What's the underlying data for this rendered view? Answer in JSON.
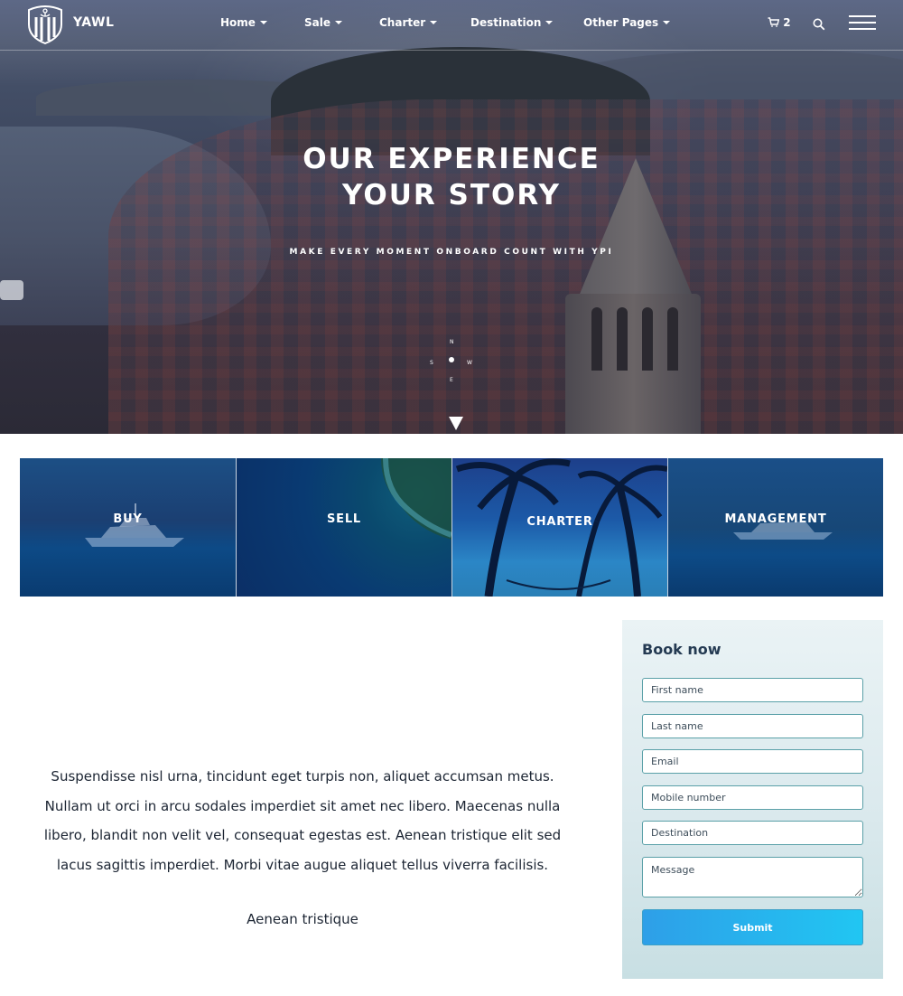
{
  "header": {
    "brand": "YAWL",
    "nav": [
      {
        "label": "Home"
      },
      {
        "label": "Sale"
      },
      {
        "label": "Charter"
      },
      {
        "label": "Destination"
      },
      {
        "label": "Other Pages"
      }
    ],
    "cart_count": "2"
  },
  "hero": {
    "title_line1": "OUR EXPERIENCE",
    "title_line2": "YOUR STORY",
    "subtitle": "MAKE EVERY MOMENT ONBOARD COUNT WITH YPI",
    "compass_letters": [
      "N",
      "W",
      "E",
      "S"
    ]
  },
  "tiles": [
    {
      "label": "BUY"
    },
    {
      "label": "SELL"
    },
    {
      "label": "CHARTER"
    },
    {
      "label": "MANAGEMENT"
    }
  ],
  "content": {
    "paragraph": "Suspendisse nisl urna, tincidunt eget turpis non, aliquet accumsan metus. Nullam ut orci in arcu sodales imperdiet sit amet nec libero. Maecenas nulla libero, blandit non velit vel, consequat egestas est. Aenean tristique elit sed lacus sagittis imperdiet. Morbi vitae augue aliquet tellus viverra facilisis.",
    "paragraph_tail": "Aenean tristique"
  },
  "booking": {
    "title": "Book now",
    "first_name_placeholder": "First name",
    "last_name_placeholder": "Last name",
    "email_placeholder": "Email",
    "mobile_placeholder": "Mobile number",
    "destination_placeholder": "Destination",
    "message_placeholder": "Message",
    "submit_label": "Submit"
  },
  "colors": {
    "accent": "#21c6f2",
    "tile_blue": "#1b3f72",
    "booking_title": "#243a52"
  }
}
